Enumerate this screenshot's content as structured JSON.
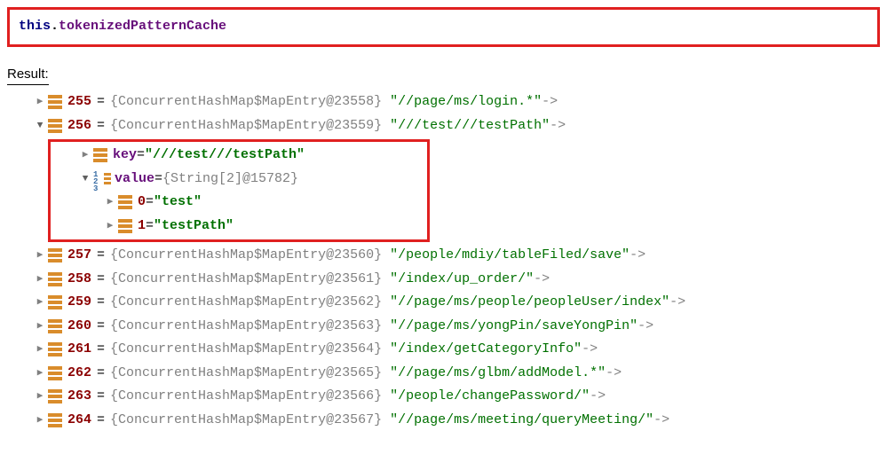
{
  "expression": {
    "this": "this",
    "dot": ".",
    "member": "tokenizedPatternCache"
  },
  "resultLabel": "Result:",
  "entries": [
    {
      "index": "255",
      "type": "{ConcurrentHashMap$MapEntry@23558}",
      "path": "\"//page/ms/login.*\"",
      "arrow": " -> ",
      "expanded": false
    },
    {
      "index": "256",
      "type": "{ConcurrentHashMap$MapEntry@23559}",
      "path": "\"///test///testPath\"",
      "arrow": " -> ",
      "expanded": true
    },
    {
      "index": "257",
      "type": "{ConcurrentHashMap$MapEntry@23560}",
      "path": "\"/people/mdiy/tableFiled/save\"",
      "arrow": " -> ",
      "expanded": false
    },
    {
      "index": "258",
      "type": "{ConcurrentHashMap$MapEntry@23561}",
      "path": "\"/index/up_order/\"",
      "arrow": " -> ",
      "expanded": false
    },
    {
      "index": "259",
      "type": "{ConcurrentHashMap$MapEntry@23562}",
      "path": "\"//page/ms/people/peopleUser/index\"",
      "arrow": " -> ",
      "expanded": false
    },
    {
      "index": "260",
      "type": "{ConcurrentHashMap$MapEntry@23563}",
      "path": "\"//page/ms/yongPin/saveYongPin\"",
      "arrow": " -> ",
      "expanded": false
    },
    {
      "index": "261",
      "type": "{ConcurrentHashMap$MapEntry@23564}",
      "path": "\"/index/getCategoryInfo\"",
      "arrow": " -> ",
      "expanded": false
    },
    {
      "index": "262",
      "type": "{ConcurrentHashMap$MapEntry@23565}",
      "path": "\"//page/ms/glbm/addModel.*\"",
      "arrow": " -> ",
      "expanded": false
    },
    {
      "index": "263",
      "type": "{ConcurrentHashMap$MapEntry@23566}",
      "path": "\"/people/changePassword/\"",
      "arrow": " -> ",
      "expanded": false
    },
    {
      "index": "264",
      "type": "{ConcurrentHashMap$MapEntry@23567}",
      "path": "\"//page/ms/meeting/queryMeeting/\"",
      "arrow": " -> ",
      "expanded": false
    }
  ],
  "expanded256": {
    "keyLabel": "key",
    "keyEq": " = ",
    "keyVal": "\"///test///testPath\"",
    "valueLabel": "value",
    "valueEq": " = ",
    "valueType": "{String[2]@15782}",
    "items": [
      {
        "idx": "0",
        "eq": " = ",
        "val": "\"test\""
      },
      {
        "idx": "1",
        "eq": " = ",
        "val": "\"testPath\""
      }
    ]
  },
  "eq": " = "
}
